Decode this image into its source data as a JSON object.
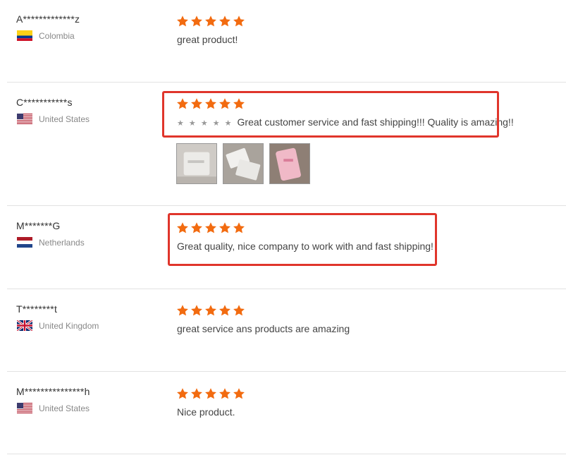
{
  "colors": {
    "star": "#f26b10",
    "highlight": "#e0352b",
    "divider": "#e2e2e2"
  },
  "reviews": [
    {
      "user": "A*************z",
      "country": "Colombia",
      "rating": 5,
      "text": "great product!"
    },
    {
      "user": "C***********s",
      "country": "United States",
      "rating": 5,
      "text_prefix": "★ ★ ★ ★ ★",
      "text": "Great customer service and fast shipping!!! Quality is amazing!!"
    },
    {
      "user": "M*******G",
      "country": "Netherlands",
      "rating": 5,
      "text": "Great quality, nice company to work with and fast shipping!"
    },
    {
      "user": "T********t",
      "country": "United Kingdom",
      "rating": 5,
      "text": "great service ans products are amazing"
    },
    {
      "user": "M***************h",
      "country": "United States",
      "rating": 5,
      "text": "Nice product."
    }
  ],
  "photos": [
    "white-package-photo",
    "white-envelopes-photo",
    "pink-package-photo"
  ]
}
